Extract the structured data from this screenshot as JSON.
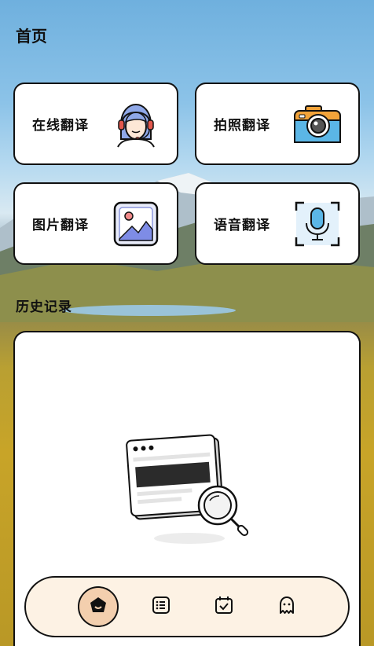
{
  "header": {
    "title": "首页"
  },
  "features": [
    {
      "label": "在线翻译",
      "icon": "customer-service-headset-icon"
    },
    {
      "label": "拍照翻译",
      "icon": "camera-icon"
    },
    {
      "label": "图片翻译",
      "icon": "image-icon"
    },
    {
      "label": "语音翻译",
      "icon": "microphone-icon"
    }
  ],
  "history": {
    "title": "历史记录"
  },
  "tabbar": {
    "items": [
      {
        "icon": "home-icon",
        "active": true
      },
      {
        "icon": "list-icon",
        "active": false
      },
      {
        "icon": "calendar-check-icon",
        "active": false
      },
      {
        "icon": "ghost-icon",
        "active": false
      }
    ]
  },
  "colors": {
    "card_border": "#111111",
    "tab_bar_bg": "#fdf2e4",
    "tab_active_bg": "#f3cfae"
  }
}
